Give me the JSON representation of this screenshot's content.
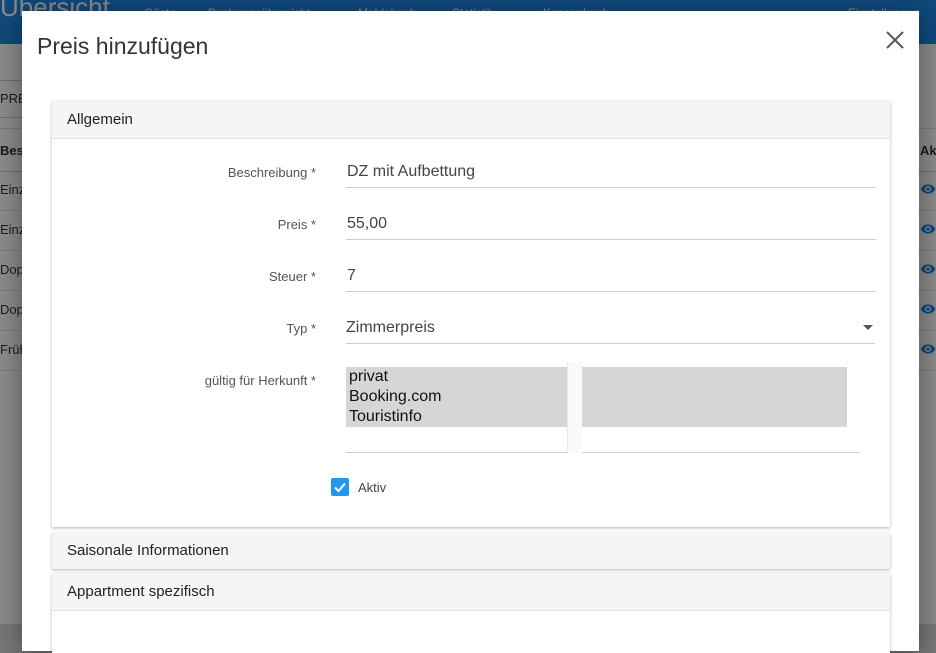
{
  "background": {
    "brand": "Übersicht",
    "nav": [
      "Gäste",
      "Buchungsübersicht",
      "Meldebuch",
      "Statistik",
      "Kassenbuch"
    ],
    "settings": "Einstellungen",
    "toolbar_button": "PREIS",
    "table_header_left": "Beschreibung",
    "table_header_right": "Ak",
    "rows": [
      "Einzelzimmer",
      "Einzelzimmer",
      "Doppelzimmer",
      "Doppelzimmer",
      "Frühstück"
    ]
  },
  "dialog": {
    "title": "Preis hinzufügen",
    "close_icon": "close-icon"
  },
  "panels": {
    "allgemein": "Allgemein",
    "saisonal": "Saisonale Informationen",
    "appartment": "Appartment spezifisch"
  },
  "form": {
    "beschreibung_label": "Beschreibung *",
    "beschreibung_value": "DZ mit Aufbettung",
    "preis_label": "Preis *",
    "preis_value": "55,00",
    "steuer_label": "Steuer *",
    "steuer_value": "7",
    "typ_label": "Typ *",
    "typ_value": "Zimmerpreis",
    "herkunft_label": "gültig für Herkunft *",
    "herkunft_options": [
      "privat",
      "Booking.com",
      "Touristinfo"
    ],
    "aktiv_label": "Aktiv",
    "aktiv_checked": true
  },
  "colors": {
    "primary": "#1e88e5",
    "checkbox": "#2196f3"
  }
}
